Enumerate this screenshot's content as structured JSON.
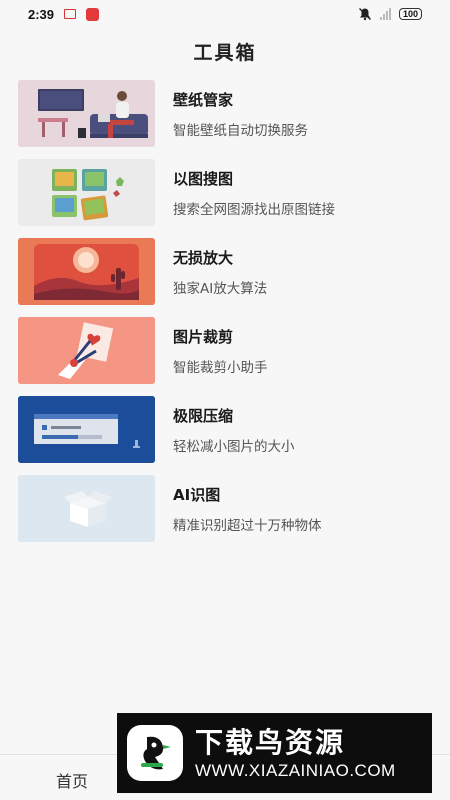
{
  "status_bar": {
    "time": "2:39",
    "battery": "100"
  },
  "header": {
    "title": "工具箱"
  },
  "tools": [
    {
      "title": "壁纸管家",
      "desc": "智能壁纸自动切换服务"
    },
    {
      "title": "以图搜图",
      "desc": "搜索全网图源找出原图链接"
    },
    {
      "title": "无损放大",
      "desc": "独家AI放大算法"
    },
    {
      "title": "图片裁剪",
      "desc": "智能裁剪小助手"
    },
    {
      "title": "极限压缩",
      "desc": "轻松减小图片的大小"
    },
    {
      "title": "AI识图",
      "desc": "精准识别超过十万种物体"
    }
  ],
  "bottom_nav": {
    "home_label": "首页"
  },
  "watermark": {
    "title": "下载鸟资源",
    "url": "WWW.XIAZAINIAO.COM"
  },
  "colors": {
    "background": "#f7f7f7",
    "status_red": "#e23a3a",
    "watermark_bg": "#0d0d0d"
  }
}
